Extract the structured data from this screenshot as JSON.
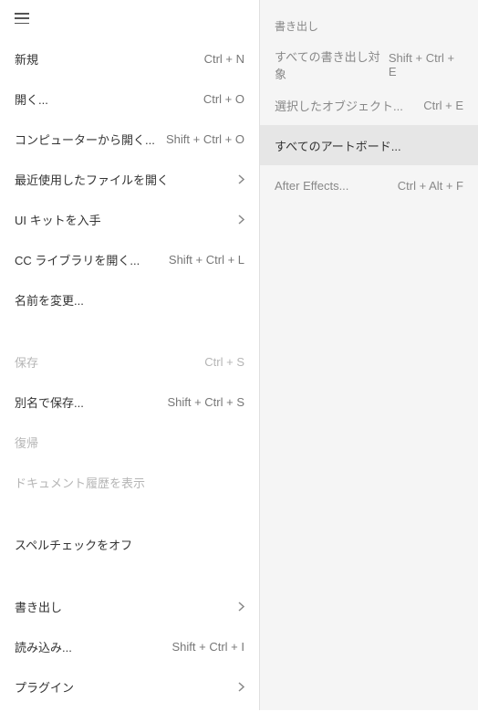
{
  "leftMenu": {
    "group1": [
      {
        "label": "新規",
        "shortcut": "Ctrl + N"
      },
      {
        "label": "開く...",
        "shortcut": "Ctrl + O"
      },
      {
        "label": "コンピューターから開く...",
        "shortcut": "Shift + Ctrl + O"
      },
      {
        "label": "最近使用したファイルを開く",
        "chevron": true
      },
      {
        "label": "UI キットを入手",
        "chevron": true
      },
      {
        "label": "CC ライブラリを開く...",
        "shortcut": "Shift + Ctrl + L"
      },
      {
        "label": "名前を変更...",
        "shortcut": ""
      }
    ],
    "group2": [
      {
        "label": "保存",
        "shortcut": "Ctrl + S",
        "disabled": true
      },
      {
        "label": "別名で保存...",
        "shortcut": "Shift + Ctrl + S"
      },
      {
        "label": "復帰",
        "shortcut": "",
        "disabled": true
      },
      {
        "label": "ドキュメント履歴を表示",
        "shortcut": "",
        "disabled": true
      }
    ],
    "group3": [
      {
        "label": "スペルチェックをオフ",
        "shortcut": ""
      }
    ],
    "group4": [
      {
        "label": "書き出し",
        "chevron": true
      },
      {
        "label": "読み込み...",
        "shortcut": "Shift + Ctrl + I"
      },
      {
        "label": "プラグイン",
        "chevron": true
      }
    ]
  },
  "rightMenu": {
    "title": "書き出し",
    "items": [
      {
        "label": "すべての書き出し対象",
        "shortcut": "Shift + Ctrl + E"
      },
      {
        "label": "選択したオブジェクト...",
        "shortcut": "Ctrl + E"
      },
      {
        "label": "すべてのアートボード...",
        "shortcut": "",
        "highlight": true
      },
      {
        "label": "After Effects...",
        "shortcut": "Ctrl + Alt + F"
      }
    ]
  }
}
